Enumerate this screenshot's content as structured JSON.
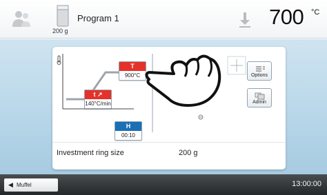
{
  "header": {
    "weight": "200 g",
    "program": "Program 1",
    "temperature": "700",
    "temperature_unit": "°C"
  },
  "program_panel": {
    "rate_button": {
      "symbol": "t ↗",
      "value": "140°C/min"
    },
    "temp_button": {
      "symbol": "T",
      "value": "900°C"
    },
    "hold_button": {
      "symbol": "H",
      "value": "00:10"
    },
    "options_label": "Options",
    "admin_label": "Admin",
    "investment_ring_label": "Investment ring size",
    "investment_ring_value": "200 g"
  },
  "footer": {
    "muffel_label": "Muffel",
    "time": "13:00:00"
  },
  "colors": {
    "red": "#e4322b",
    "blue": "#1a6fb5",
    "background": "#b9d7e9"
  },
  "icons": [
    "user-icon",
    "weight-icon",
    "download-icon",
    "thermometer-icon",
    "hand-pointer-icon",
    "options-icon",
    "admin-icon",
    "back-arrow-icon"
  ]
}
